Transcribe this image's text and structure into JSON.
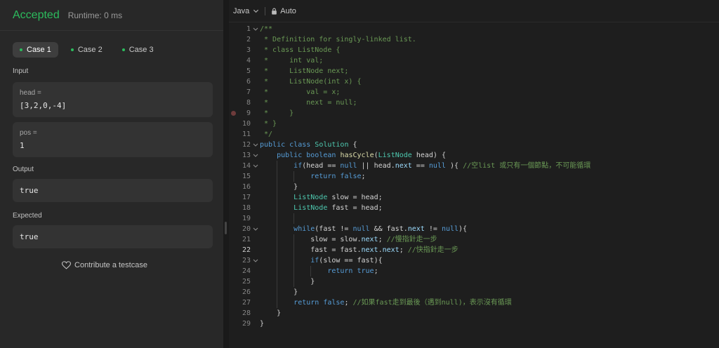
{
  "result": {
    "status": "Accepted",
    "runtime": "Runtime: 0 ms"
  },
  "cases": [
    {
      "label": "Case 1"
    },
    {
      "label": "Case 2"
    },
    {
      "label": "Case 3"
    }
  ],
  "input": {
    "label": "Input",
    "params": [
      {
        "name": "head =",
        "value": "[3,2,0,-4]"
      },
      {
        "name": "pos =",
        "value": "1"
      }
    ]
  },
  "output": {
    "label": "Output",
    "value": "true"
  },
  "expected": {
    "label": "Expected",
    "value": "true"
  },
  "contribute": {
    "label": "Contribute a testcase",
    "icon": "heart-icon"
  },
  "editor": {
    "language": "Java",
    "mode": "Auto",
    "mode_icon": "lock-icon",
    "current_line": 22,
    "breakpoint_line": 9,
    "lines": [
      "/**",
      " * Definition for singly-linked list.",
      " * class ListNode {",
      " *     int val;",
      " *     ListNode next;",
      " *     ListNode(int x) {",
      " *         val = x;",
      " *         next = null;",
      " *     }",
      " * }",
      " */",
      "public class Solution {",
      "    public boolean hasCycle(ListNode head) {",
      "        if(head == null || head.next == null ){ //空list 或只有一個節點，不可能循環",
      "            return false;",
      "        }",
      "        ListNode slow = head;",
      "        ListNode fast = head;",
      "",
      "        while(fast != null && fast.next != null){",
      "            slow = slow.next; //慢指針走一步",
      "            fast = fast.next.next; //快指針走一步",
      "            if(slow == fast){",
      "                return true;",
      "            }",
      "        }",
      "        return false; //如果fast走到最後（遇到null)，表示沒有循環",
      "    }",
      "}"
    ]
  }
}
